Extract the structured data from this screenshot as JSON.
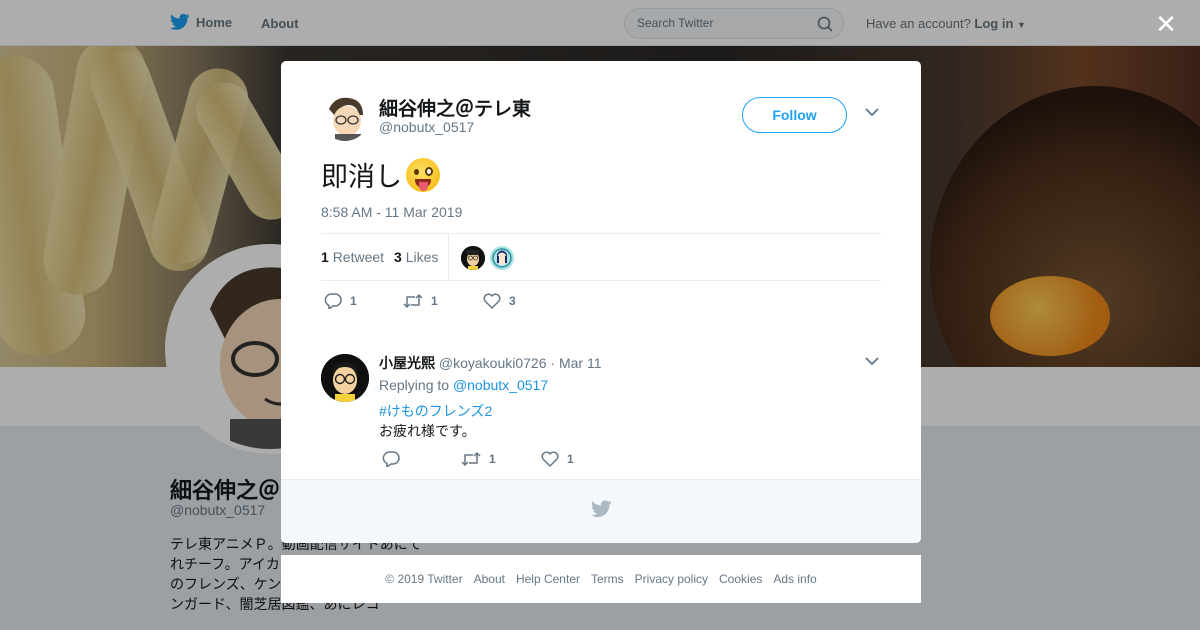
{
  "topbar": {
    "home_label": "Home",
    "about_label": "About",
    "search_placeholder": "Search Twitter",
    "account_prompt": "Have an account?",
    "login_label": "Log in"
  },
  "background_profile": {
    "name": "細谷伸之＠テ",
    "handle": "@nobutx_0517",
    "bio": "テレ東アニメＰ。動画配信サイトあにてれチーフ。アイカ ツ！アイカツスタ けものフレンズ、ケンハン、ハスキー、ヴァンガード、闇芝居図鑑、あにレコ"
  },
  "modal": {
    "author_name": "細谷伸之＠テレ東",
    "author_handle": "@nobutx_0517",
    "follow_label": "Follow",
    "tweet_text": "即消し",
    "tweet_time": "8:58 AM - 11 Mar 2019",
    "retweet_count": "1",
    "retweet_label": "Retweet",
    "likes_count": "3",
    "likes_label": "Likes",
    "actions": {
      "reply_count": "1",
      "retweet_count": "1",
      "like_count": "3"
    }
  },
  "reply": {
    "author_name": "小屋光熙",
    "author_handle": "@koyakouki0726",
    "date": "· Mar 11",
    "replying_prefix": "Replying to",
    "replying_to": "@nobutx_0517",
    "hashtag": "#けものフレンズ2",
    "text": "お疲れ様です。",
    "actions": {
      "reply_count": "",
      "retweet_count": "1",
      "like_count": "1"
    }
  },
  "footer": {
    "copyright": "© 2019 Twitter",
    "links": [
      "About",
      "Help Center",
      "Terms",
      "Privacy policy",
      "Cookies",
      "Ads info"
    ]
  },
  "colors": {
    "accent": "#1da1f2",
    "link": "#1b95e0",
    "muted": "#657786"
  }
}
